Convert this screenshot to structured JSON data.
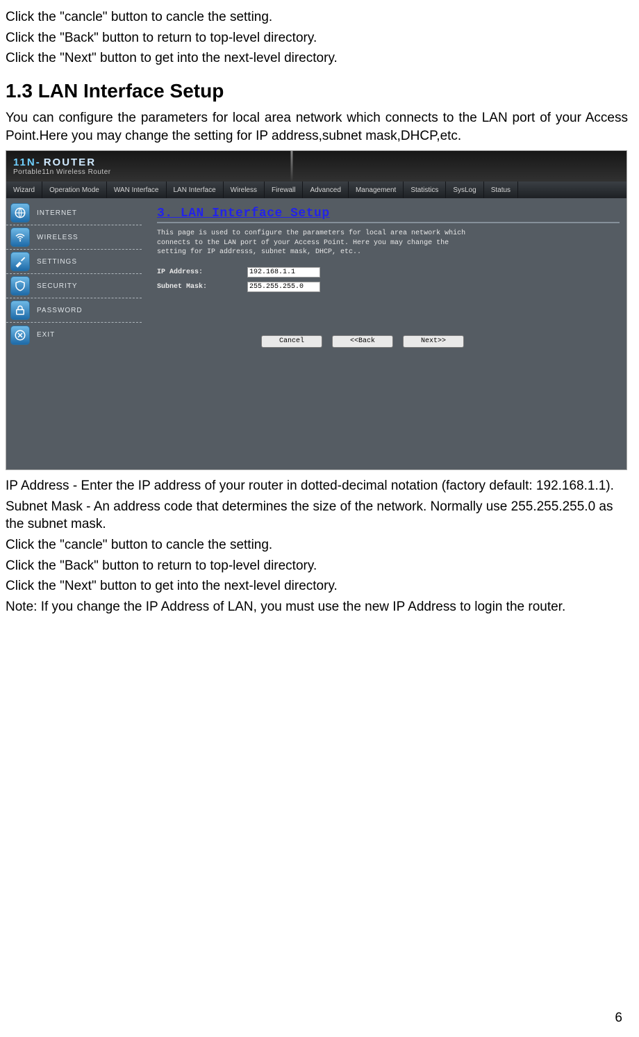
{
  "doc": {
    "intro_lines": {
      "line1": "Click the   \"cancle\" button to cancle the setting.",
      "line2": "Click the \"Back\" button to return to top-level directory.",
      "line3": "Click the \"Next\" button to get into the next-level directory."
    },
    "heading": "1.3 LAN Interface Setup",
    "intro_para": "You can configure the parameters for local area network which connects to the LAN port of your Access Point.Here you may change the setting for IP address,subnet mask,DHCP,etc.",
    "after_shot": {
      "l1": "IP Address - Enter the IP address of your router in dotted-decimal notation (factory default: 192.168.1.1).",
      "l2": "Subnet Mask - An address code that determines the size of the network. Normally use 255.255.255.0 as the subnet mask.",
      "l3": "Click the   \"cancle\" button to cancle the setting.",
      "l4": "Click the \"Back\" button to return to top-level directory.",
      "l5": "Click the \"Next\" button to get into the next-level directory.",
      "l6": "Note: If you change the IP Address of LAN, you must use the new IP Address to login the router."
    },
    "page_number": "6"
  },
  "router": {
    "brand": {
      "prefix": "11n-",
      "suffix": "ROUTER",
      "sub": "Portable11n Wireless Router"
    },
    "topnav": [
      "Wizard",
      "Operation Mode",
      "WAN Interface",
      "LAN Interface",
      "Wireless",
      "Firewall",
      "Advanced",
      "Management",
      "Statistics",
      "SysLog",
      "Status"
    ],
    "sidebar": [
      {
        "label": "INTERNET"
      },
      {
        "label": "WIRELESS"
      },
      {
        "label": "SETTINGS"
      },
      {
        "label": "SECURITY"
      },
      {
        "label": "PASSWORD"
      },
      {
        "label": "EXIT"
      }
    ],
    "panel": {
      "title": "3. LAN Interface Setup",
      "desc": "This page is used to configure the parameters for local area network which connects to the LAN port of your Access Point. Here you may change the setting for IP addresss, subnet mask, DHCP, etc..",
      "fields": {
        "ip_label": "IP Address:",
        "ip_value": "192.168.1.1",
        "mask_label": "Subnet Mask:",
        "mask_value": "255.255.255.0"
      },
      "buttons": {
        "cancel": "Cancel",
        "back": "<<Back",
        "next": "Next>>"
      }
    }
  }
}
